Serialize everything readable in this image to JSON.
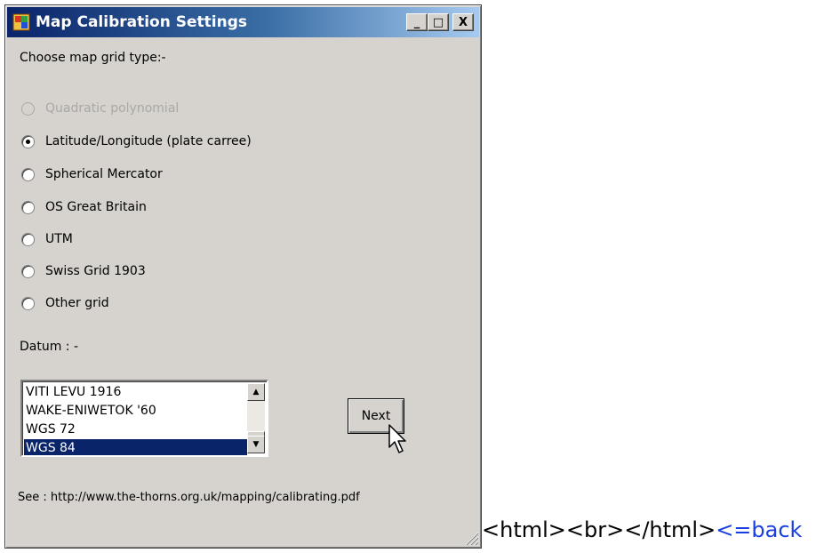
{
  "window": {
    "title": "Map Calibration Settings",
    "controls": {
      "minimize": "_",
      "maximize": "□",
      "close": "X"
    },
    "app_icon": "app-icon"
  },
  "grid": {
    "prompt": "Choose map grid type:-",
    "options": [
      {
        "label": "Quadratic polynomial",
        "checked": false,
        "disabled": true
      },
      {
        "label": "Latitude/Longitude (plate carree)",
        "checked": true,
        "disabled": false
      },
      {
        "label": "Spherical Mercator",
        "checked": false,
        "disabled": false
      },
      {
        "label": "OS Great Britain",
        "checked": false,
        "disabled": false
      },
      {
        "label": "UTM",
        "checked": false,
        "disabled": false
      },
      {
        "label": "Swiss Grid 1903",
        "checked": false,
        "disabled": false
      },
      {
        "label": "Other grid",
        "checked": false,
        "disabled": false
      }
    ]
  },
  "datum": {
    "label": "Datum : -",
    "items": [
      "VITI LEVU 1916",
      "WAKE-ENIWETOK '60",
      "WGS 72",
      "WGS 84"
    ],
    "selected": "WGS 84",
    "scroll_up_glyph": "▲",
    "scroll_down_glyph": "▼"
  },
  "next_button": "Next",
  "see_text": "See : http://www.the-thorns.org.uk/mapping/calibrating.pdf",
  "trailing": {
    "html_text": "<html><br></html>",
    "back_link": "<=back"
  },
  "colors": {
    "face": "#d6d3ce",
    "title_start": "#0a246a",
    "title_end": "#a6caf0",
    "selection": "#0a246a",
    "link": "#1a3fe0"
  }
}
